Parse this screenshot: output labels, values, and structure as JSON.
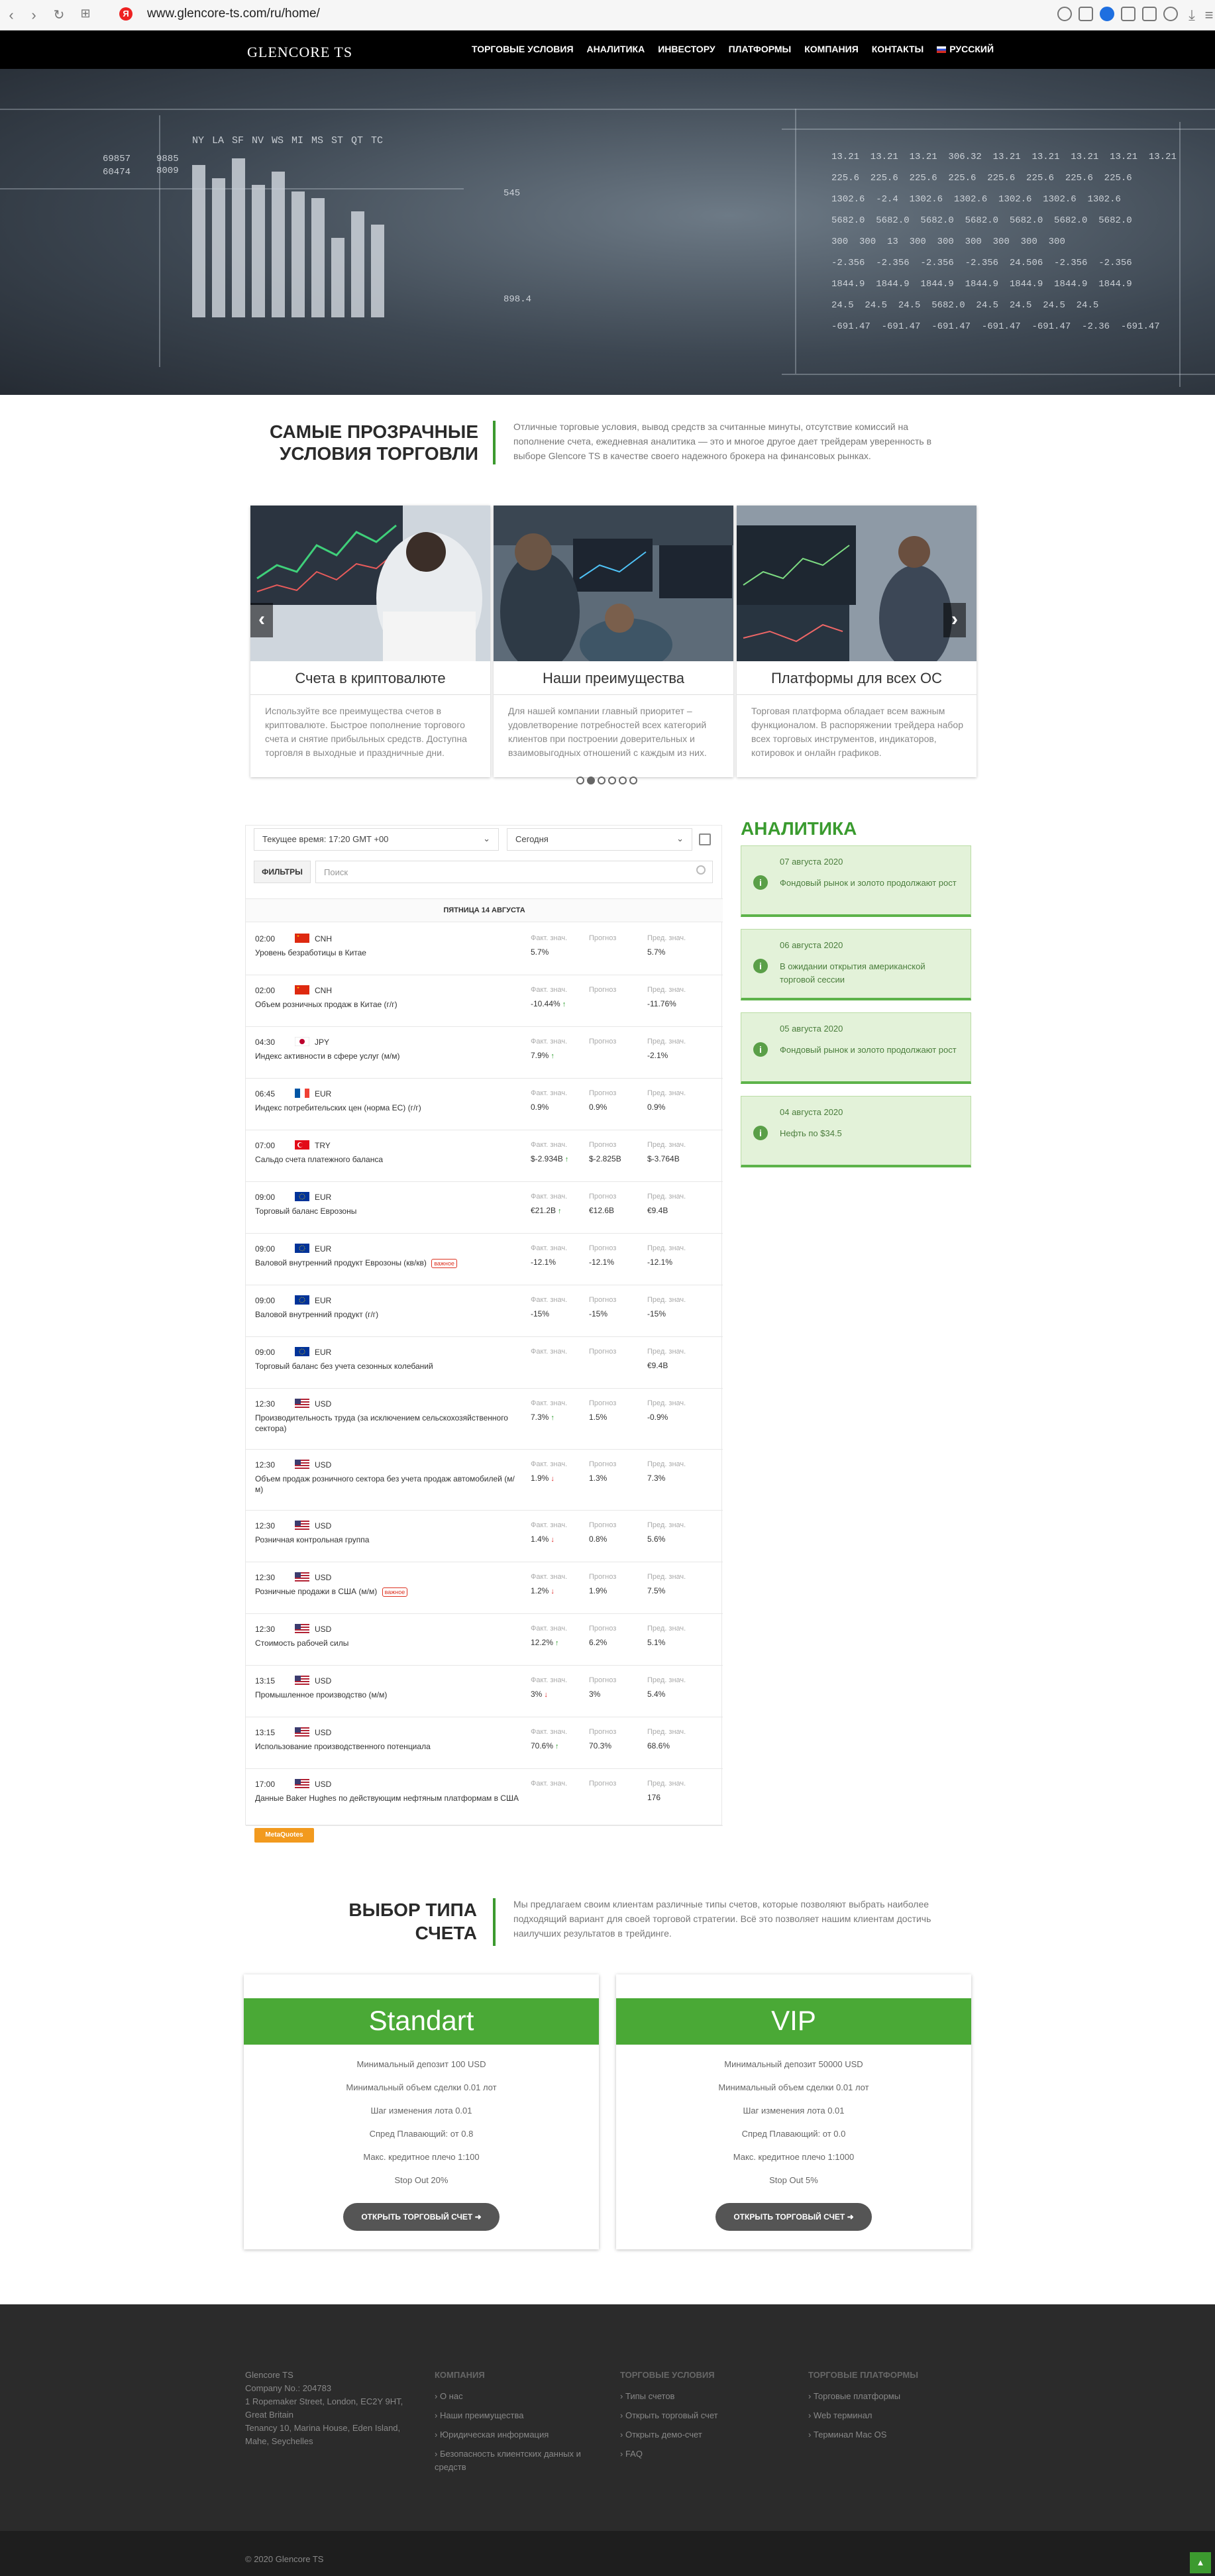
{
  "browser": {
    "url": "www.glencore-ts.com/ru/home/"
  },
  "header": {
    "logo": "GLENCORE TS",
    "menu": [
      "ТОРГОВЫЕ УСЛОВИЯ",
      "АНАЛИТИКА",
      "ИНВЕСТОРУ",
      "ПЛАТФОРМЫ",
      "КОМПАНИЯ",
      "КОНТАКТЫ"
    ],
    "language": "РУССКИЙ"
  },
  "hero": {
    "bar_labels": [
      "NY",
      "LA",
      "SF",
      "NV",
      "WS",
      "MI",
      "MS",
      "ST",
      "QT",
      "TC"
    ],
    "table_rows": [
      "13.21  13.21  13.21  306.32  13.21  13.21  13.21  13.21  13.21",
      "225.6  225.6  225.6  225.6  225.6  225.6  225.6  225.6",
      "1302.6  -2.4  1302.6  1302.6  1302.6  1302.6  1302.6",
      "5682.0  5682.0  5682.0  5682.0  5682.0  5682.0  5682.0",
      "300  300  13  300  300  300  300  300  300",
      "-2.356  -2.356  -2.356  -2.356  24.506  -2.356  -2.356",
      "1844.9  1844.9  1844.9  1844.9  1844.9  1844.9  1844.9",
      "24.5  24.5  24.5  5682.0  24.5  24.5  24.5  24.5",
      "-691.47  -691.47  -691.47  -691.47  -691.47  -2.36  -691.47"
    ],
    "side_numbers": [
      "69857",
      "60474",
      "9885",
      "8009",
      "545",
      "898.4"
    ]
  },
  "intro": {
    "title": "САМЫЕ ПРОЗРАЧНЫЕ УСЛОВИЯ ТОРГОВЛИ",
    "text": "Отличные торговые условия, вывод средств за считанные минуты, отсутствие комиссий на пополнение счета, ежедневная аналитика — это и многое другое дает трейдерам уверенность в выборе Glencore TS в качестве своего надежного брокера на финансовых рынках."
  },
  "slides": [
    {
      "title": "Счета в криптовалюте",
      "text": "Используйте все преимущества счетов в криптовалюте. Быстрое пополнение торгового счета и снятие прибыльных средств. Доступна торговля в выходные и праздничные дни."
    },
    {
      "title": "Наши преимущества",
      "text": "Для нашей компании главный приоритет – удовлетворение потребностей всех категорий клиентов при построении доверительных и взаимовыгодных отношений с каждым из них."
    },
    {
      "title": "Платформы для всех ОС",
      "text": "Торговая платформа обладает всем важным функционалом. В распоряжении трейдера набор всех торговых инструментов, индикаторов, котировок и онлайн графиков."
    }
  ],
  "calendar": {
    "time_select": "Текущее время: 17:20  GMT +00",
    "date_select": "Сегодня",
    "filters_label": "ФИЛЬТРЫ",
    "search_placeholder": "Поиск",
    "day_header": "ПЯТНИЦА 14 АВГУСТА",
    "col_actual": "Факт. знач.",
    "col_forecast": "Прогноз",
    "col_previous": "Пред. знач.",
    "events": [
      {
        "time": "02:00",
        "currency": "CNH",
        "flag": "cn",
        "name": "Уровень безработицы в Китае",
        "badge": "",
        "actual": "5.7%",
        "trend": "",
        "forecast": "",
        "previous": "5.7%"
      },
      {
        "time": "02:00",
        "currency": "CNH",
        "flag": "cn",
        "name": "Объем розничных продаж в Китае (г/г)",
        "badge": "",
        "actual": "-10.44%",
        "trend": "up",
        "forecast": "",
        "previous": "-11.76%"
      },
      {
        "time": "04:30",
        "currency": "JPY",
        "flag": "jp",
        "name": "Индекс активности в сфере услуг (м/м)",
        "badge": "",
        "actual": "7.9%",
        "trend": "up",
        "forecast": "",
        "previous": "-2.1%"
      },
      {
        "time": "06:45",
        "currency": "EUR",
        "flag": "fr",
        "name": "Индекс потребительских цен (норма ЕС) (г/г)",
        "badge": "",
        "actual": "0.9%",
        "trend": "",
        "forecast": "0.9%",
        "previous": "0.9%"
      },
      {
        "time": "07:00",
        "currency": "TRY",
        "flag": "tr",
        "name": "Сальдо счета платежного баланса",
        "badge": "",
        "actual": "$-2.934B",
        "trend": "up",
        "forecast": "$-2.825B",
        "previous": "$-3.764B"
      },
      {
        "time": "09:00",
        "currency": "EUR",
        "flag": "eu",
        "name": "Торговый баланс Еврозоны",
        "badge": "",
        "actual": "€21.2B",
        "trend": "up",
        "forecast": "€12.6B",
        "previous": "€9.4B"
      },
      {
        "time": "09:00",
        "currency": "EUR",
        "flag": "eu",
        "name": "Валовой внутренний продукт Еврозоны (кв/кв)",
        "badge": "важное",
        "actual": "-12.1%",
        "trend": "",
        "forecast": "-12.1%",
        "previous": "-12.1%"
      },
      {
        "time": "09:00",
        "currency": "EUR",
        "flag": "eu",
        "name": "Валовой внутренний продукт (г/г)",
        "badge": "",
        "actual": "-15%",
        "trend": "",
        "forecast": "-15%",
        "previous": "-15%"
      },
      {
        "time": "09:00",
        "currency": "EUR",
        "flag": "eu",
        "name": "Торговый баланс без учета сезонных колебаний",
        "badge": "",
        "actual": "",
        "trend": "",
        "forecast": "",
        "previous": "€9.4B"
      },
      {
        "time": "12:30",
        "currency": "USD",
        "flag": "us",
        "name": "Производительность труда (за исключением сельскохозяйственного сектора)",
        "badge": "",
        "actual": "7.3%",
        "trend": "up",
        "forecast": "1.5%",
        "previous": "-0.9%"
      },
      {
        "time": "12:30",
        "currency": "USD",
        "flag": "us",
        "name": "Объем продаж розничного сектора без учета продаж автомобилей (м/м)",
        "badge": "",
        "actual": "1.9%",
        "trend": "down",
        "forecast": "1.3%",
        "previous": "7.3%"
      },
      {
        "time": "12:30",
        "currency": "USD",
        "flag": "us",
        "name": "Розничная контрольная группа",
        "badge": "",
        "actual": "1.4%",
        "trend": "down",
        "forecast": "0.8%",
        "previous": "5.6%"
      },
      {
        "time": "12:30",
        "currency": "USD",
        "flag": "us",
        "name": "Розничные продажи в США (м/м)",
        "badge": "важное",
        "actual": "1.2%",
        "trend": "down",
        "forecast": "1.9%",
        "previous": "7.5%"
      },
      {
        "time": "12:30",
        "currency": "USD",
        "flag": "us",
        "name": "Стоимость рабочей силы",
        "badge": "",
        "actual": "12.2%",
        "trend": "up",
        "forecast": "6.2%",
        "previous": "5.1%"
      },
      {
        "time": "13:15",
        "currency": "USD",
        "flag": "us",
        "name": "Промышленное производство (м/м)",
        "badge": "",
        "actual": "3%",
        "trend": "down",
        "forecast": "3%",
        "previous": "5.4%"
      },
      {
        "time": "13:15",
        "currency": "USD",
        "flag": "us",
        "name": "Использование производственного потенциала",
        "badge": "",
        "actual": "70.6%",
        "trend": "up",
        "forecast": "70.3%",
        "previous": "68.6%"
      },
      {
        "time": "17:00",
        "currency": "USD",
        "flag": "us",
        "name": "Данные Baker Hughes по действующим нефтяным платформам в США",
        "badge": "",
        "actual": "",
        "trend": "",
        "forecast": "",
        "previous": "176"
      }
    ],
    "badge_brand": "MetaQuotes"
  },
  "analytics": {
    "title": "АНАЛИТИКА",
    "items": [
      {
        "date": "07 августа 2020",
        "text": "Фондовый рынок и золото продолжают рост"
      },
      {
        "date": "06 августа 2020",
        "text": "В ожидании открытия американской торговой сессии"
      },
      {
        "date": "05 августа 2020",
        "text": "Фондовый рынок и золото продолжают рост"
      },
      {
        "date": "04 августа 2020",
        "text": "Нефть по $34.5"
      }
    ]
  },
  "accounts": {
    "title": "ВЫБОР ТИПА СЧЕТА",
    "text": "Мы предлагаем своим клиентам различные типы счетов, которые позволяют выбрать наиболее подходящий вариант для своей торговой стратегии. Всё это позволяет нашим клиентам достичь наилучших результатов в трейдинге.",
    "cards": [
      {
        "name": "Standart",
        "features": [
          "Минимальный депозит 100 USD",
          "Минимальный объем сделки 0.01 лот",
          "Шаг изменения лота 0.01",
          "Спред Плавающий: от 0.8",
          "Макс. кредитное плечо 1:100",
          "Stop Out 20%"
        ],
        "button": "ОТКРЫТЬ ТОРГОВЫЙ СЧЕТ"
      },
      {
        "name": "VIP",
        "features": [
          "Минимальный депозит 50000 USD",
          "Минимальный объем сделки 0.01 лот",
          "Шаг изменения лота 0.01",
          "Спред Плавающий: от 0.0",
          "Макс. кредитное плечо 1:1000",
          "Stop Out 5%"
        ],
        "button": "ОТКРЫТЬ ТОРГОВЫЙ СЧЕТ"
      }
    ]
  },
  "footer": {
    "company_lines": [
      "Glencore TS",
      "Company No.: 204783",
      "1 Ropemaker Street, London, EC2Y 9HT, Great Britain",
      "Tenancy 10, Marina House, Eden Island, Mahe, Seychelles"
    ],
    "columns": [
      {
        "heading": "КОМПАНИЯ",
        "items": [
          "О нас",
          "Наши преимущества",
          "Юридическая информация",
          "Безопасность клиентских данных и средств"
        ]
      },
      {
        "heading": "ТОРГОВЫЕ УСЛОВИЯ",
        "items": [
          "Типы счетов",
          "Открыть торговый счет",
          "Открыть демо-счет",
          "FAQ"
        ]
      },
      {
        "heading": "ТОРГОВЫЕ ПЛАТФОРМЫ",
        "items": [
          "Торговые платформы",
          "Web терминал",
          "Терминал Mac OS"
        ]
      }
    ],
    "copyright": "© 2020 Glencore TS"
  }
}
